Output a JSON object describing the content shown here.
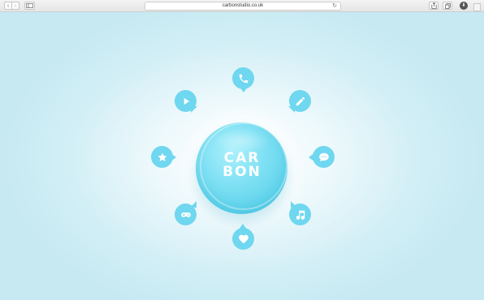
{
  "browser": {
    "url": "carbonstudio.co.uk",
    "back_glyph": "‹",
    "forward_glyph": "›",
    "reload_glyph": "↻",
    "download_glyph": "⬇"
  },
  "logo": {
    "line1": "CAR",
    "line2": "BON"
  },
  "nav_icons": [
    {
      "icon": "phone-icon"
    },
    {
      "icon": "pencil-icon"
    },
    {
      "icon": "chat-icon"
    },
    {
      "icon": "music-note-icon"
    },
    {
      "icon": "heart-icon"
    },
    {
      "icon": "gamepad-icon"
    },
    {
      "icon": "star-icon"
    },
    {
      "icon": "play-icon"
    }
  ],
  "colors": {
    "accent": "#6fd7ef",
    "background": "#d3eff6"
  }
}
